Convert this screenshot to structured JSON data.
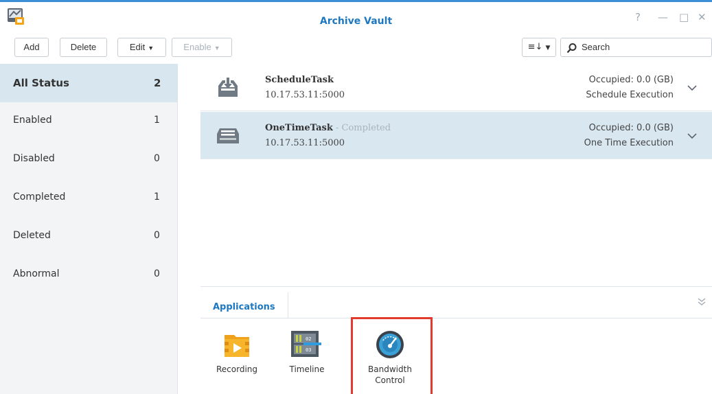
{
  "window": {
    "title": "Archive Vault",
    "accent_color": "#3b8fd6",
    "help_icon": "?",
    "minimize_icon": "—",
    "maximize_icon": "□",
    "close_icon": "✕"
  },
  "toolbar": {
    "add_label": "Add",
    "delete_label": "Delete",
    "edit_label": "Edit",
    "enable_label": "Enable",
    "sort_icon": "≡↓",
    "search_placeholder": "Search"
  },
  "sidebar": {
    "items": [
      {
        "label": "All Status",
        "count": "2"
      },
      {
        "label": "Enabled",
        "count": "1"
      },
      {
        "label": "Disabled",
        "count": "0"
      },
      {
        "label": "Completed",
        "count": "1"
      },
      {
        "label": "Deleted",
        "count": "0"
      },
      {
        "label": "Abnormal",
        "count": "0"
      }
    ]
  },
  "tasks": [
    {
      "name": "ScheduleTask",
      "status": "",
      "address": "10.17.53.11:5000",
      "occupied": "Occupied: 0.0 (GB)",
      "type": "Schedule Execution"
    },
    {
      "name": "OneTimeTask",
      "status": " - Completed",
      "address": "10.17.53.11:5000",
      "occupied": "Occupied: 0.0 (GB)",
      "type": "One Time Execution"
    }
  ],
  "apps": {
    "tab_label": "Applications",
    "items": [
      {
        "label": "Recording",
        "icon": "recording-icon"
      },
      {
        "label": "Timeline",
        "icon": "timeline-icon"
      },
      {
        "label": "Bandwidth Control",
        "icon": "bandwidth-gauge-icon"
      }
    ],
    "highlight_color": "#e23b2e"
  }
}
